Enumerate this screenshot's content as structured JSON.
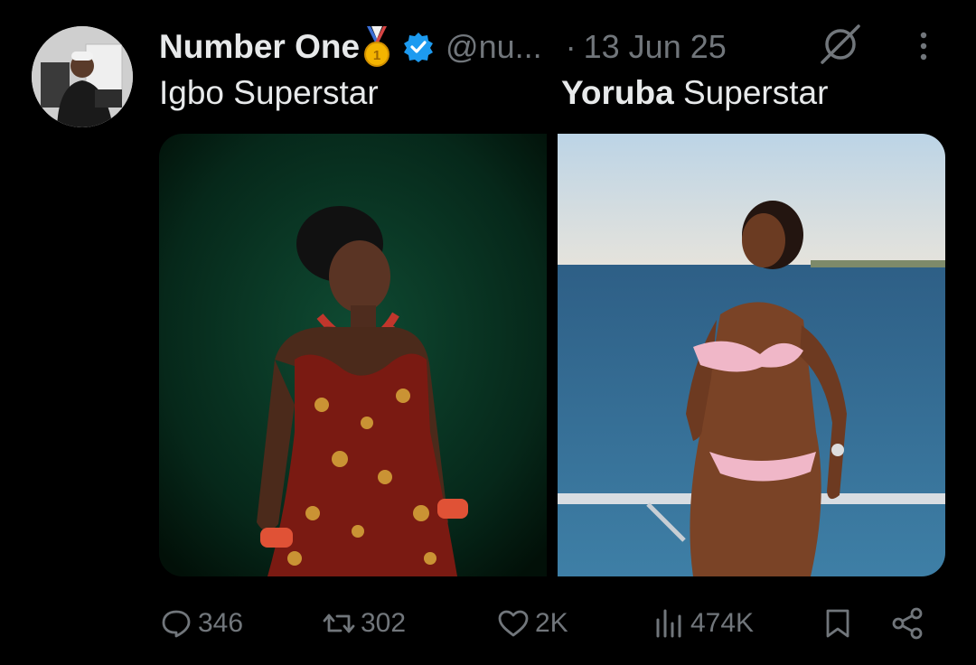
{
  "author": {
    "name": "Number One",
    "medal_emoji": "🥇",
    "verified_icon": "verified-badge-icon",
    "handle": "@nu...",
    "separator": "·",
    "date": "13 Jun 25"
  },
  "tweet": {
    "caption_left": "Igbo Superstar",
    "caption_right_bold": "Yoruba",
    "caption_right_rest": " Superstar"
  },
  "media": {
    "left_image": "Woman in red-and-gold print dress with coral beads against a dark green backdrop",
    "right_image": "Woman in pink bikini posing on a boat railing with the sea behind"
  },
  "actions": {
    "replies": "346",
    "reposts": "302",
    "likes": "2K",
    "views": "474K"
  },
  "colors": {
    "background": "#000000",
    "text": "#e7e9ea",
    "muted": "#71767b",
    "verified": "#1d9bf0"
  }
}
